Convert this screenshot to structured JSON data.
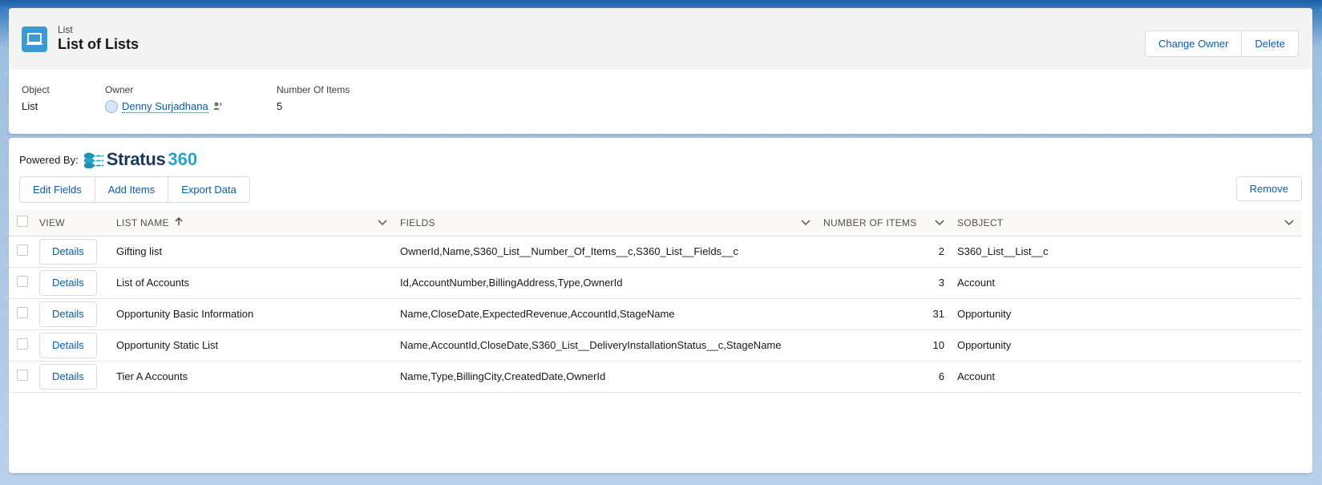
{
  "header": {
    "entity_label": "List",
    "title": "List of Lists",
    "actions": [
      "Change Owner",
      "Delete"
    ]
  },
  "highlights": {
    "object_label": "Object",
    "object_value": "List",
    "owner_label": "Owner",
    "owner_value": "Denny Surjadhana",
    "items_label": "Number Of Items",
    "items_value": "5"
  },
  "main": {
    "powered_by": "Powered By:",
    "logo_text": "Stratus",
    "logo_num": "360",
    "toolbar": [
      "Edit Fields",
      "Add Items",
      "Export Data"
    ],
    "remove_label": "Remove",
    "columns": [
      "View",
      "List Name",
      "Fields",
      "Number Of Items",
      "SObject"
    ],
    "rows": [
      {
        "action": "Details",
        "name": "Gifting list",
        "fields": "OwnerId,Name,S360_List__Number_Of_Items__c,S360_List__Fields__c",
        "count": "2",
        "sobject": "S360_List__List__c"
      },
      {
        "action": "Details",
        "name": "List of Accounts",
        "fields": "Id,AccountNumber,BillingAddress,Type,OwnerId",
        "count": "3",
        "sobject": "Account"
      },
      {
        "action": "Details",
        "name": "Opportunity Basic Information",
        "fields": "Name,CloseDate,ExpectedRevenue,AccountId,StageName",
        "count": "31",
        "sobject": "Opportunity"
      },
      {
        "action": "Details",
        "name": "Opportunity Static List",
        "fields": "Name,AccountId,CloseDate,S360_List__DeliveryInstallationStatus__c,StageName",
        "count": "10",
        "sobject": "Opportunity"
      },
      {
        "action": "Details",
        "name": "Tier A Accounts",
        "fields": "Name,Type,BillingCity,CreatedDate,OwnerId",
        "count": "6",
        "sobject": "Account"
      }
    ]
  },
  "colors": {
    "accent": "#0b5cab",
    "entity_icon": "#3b9ad1"
  }
}
